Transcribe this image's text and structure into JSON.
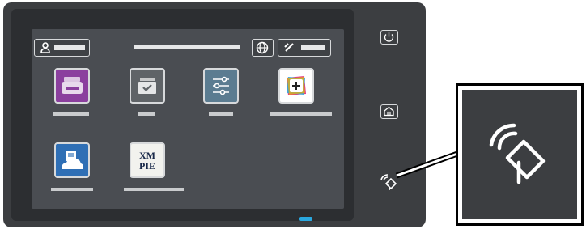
{
  "device": {
    "screen": {
      "topbar": {
        "user_icon": "person-icon",
        "language_icon": "globe-icon",
        "edit_icon": "pencil-icon"
      },
      "apps": [
        {
          "icon": "printer-icon",
          "color": "#8b3f9e"
        },
        {
          "icon": "tray-check-icon",
          "color": "#5f6367"
        },
        {
          "icon": "sliders-icon",
          "color": "#5b7c91"
        },
        {
          "icon": "add-app-icon",
          "color": "#ffffff"
        },
        {
          "icon": "cloud-document-icon",
          "color": "#2f6fb5"
        },
        {
          "icon": "xmpie-logo",
          "color": "#f2f2ee",
          "logo_text": "XM\nPIE"
        }
      ]
    },
    "side_buttons": {
      "power_icon": "power-icon",
      "home_icon": "home-icon",
      "nfc_icon": "nfc-icon"
    }
  },
  "callout": {
    "icon": "nfc-icon"
  }
}
